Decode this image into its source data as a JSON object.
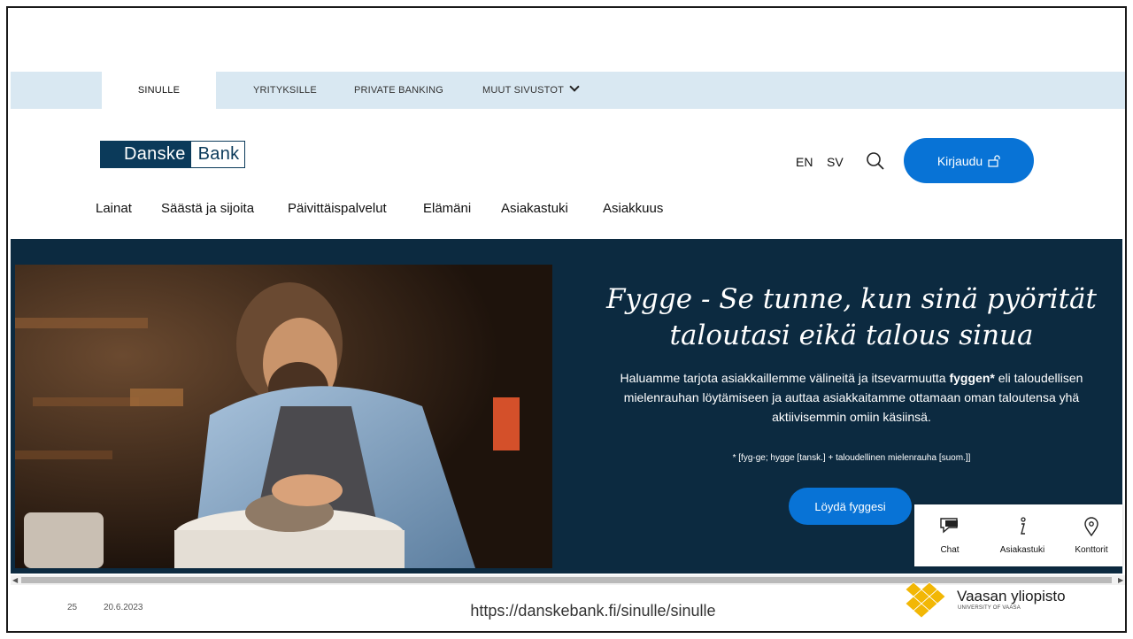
{
  "topbar": {
    "tabs": [
      "SINULLE",
      "YRITYKSILLE",
      "PRIVATE BANKING",
      "MUUT SIVUSTOT"
    ]
  },
  "logo": {
    "part1": "Danske",
    "part2": "Bank"
  },
  "header": {
    "lang_en": "EN",
    "lang_sv": "SV",
    "login_label": "Kirjaudu"
  },
  "nav": [
    "Lainat",
    "Säästä ja sijoita",
    "Päivittäispalvelut",
    "Elämäni",
    "Asiakastuki",
    "Asiakkuus"
  ],
  "hero": {
    "title": "Fygge - Se tunne, kun sinä pyörität taloutasi eikä talous sinua",
    "body_pre": "Haluamme tarjota asiakkaillemme välineitä ja itsevarmuutta ",
    "body_bold": "fyggen*",
    "body_post": " eli taloudellisen mielenrauhan löytämiseen ja auttaa asiakkaitamme ottamaan oman taloutensa yhä aktiivisemmin omiin käsiinsä.",
    "note": "* [fyg-ge; hygge [tansk.] + taloudellinen mielenrauha [suom.]]",
    "cta": "Löydä fyggesi"
  },
  "help": [
    "Chat",
    "Asiakastuki",
    "Konttorit"
  ],
  "colors": {
    "accent": "#0873d6",
    "hero_bg": "#0c2a40",
    "topbar_bg": "#d9e8f2",
    "brand": "#0b3a5a",
    "uni_gold": "#f2b705"
  },
  "footer": {
    "slide_number": "25",
    "date": "20.6.2023",
    "url": "https://danskebank.fi/sinulle/sinulle",
    "uni_name": "Vaasan yliopisto",
    "uni_sub": "UNIVERSITY OF VAASA"
  }
}
